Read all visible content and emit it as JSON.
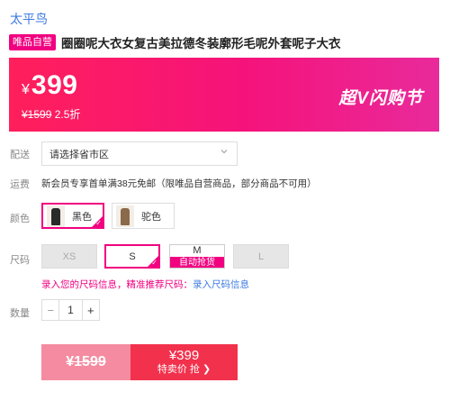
{
  "brand": "太平鸟",
  "product": {
    "tag": "唯品自营",
    "title": "圈圈呢大衣女复古美拉德冬装廓形毛呢外套呢子大衣"
  },
  "price": {
    "currency": "¥",
    "current": "399",
    "original": "¥1599",
    "discount": "2.5折",
    "banner_label": "超V闪购节"
  },
  "shipping": {
    "delivery_label": "配送",
    "delivery_placeholder": "请选择省市区",
    "fee_label": "运费",
    "fee_text": "新会员专享首单满38元免邮（限唯品自营商品，部分商品不可用）"
  },
  "color": {
    "label": "颜色",
    "options": [
      {
        "name": "黑色",
        "selected": true
      },
      {
        "name": "驼色",
        "selected": false
      }
    ]
  },
  "size": {
    "label": "尺码",
    "options": [
      "XS",
      "S",
      "M",
      "L"
    ],
    "promo_text": "自动抢货",
    "hint_text": "录入您的尺码信息，精准推荐尺码：",
    "hint_link": "录入尺码信息"
  },
  "quantity": {
    "label": "数量",
    "minus": "−",
    "value": "1",
    "plus": "+"
  },
  "buy_bar": {
    "original_price": "¥1599",
    "sale_price": "¥399",
    "action_label": "特卖价 抢 ❯"
  },
  "colors": {
    "accent": "#f10180",
    "buy_red": "#f2314c",
    "buy_pink": "#f58ba0",
    "link_blue": "#3d7be0"
  }
}
